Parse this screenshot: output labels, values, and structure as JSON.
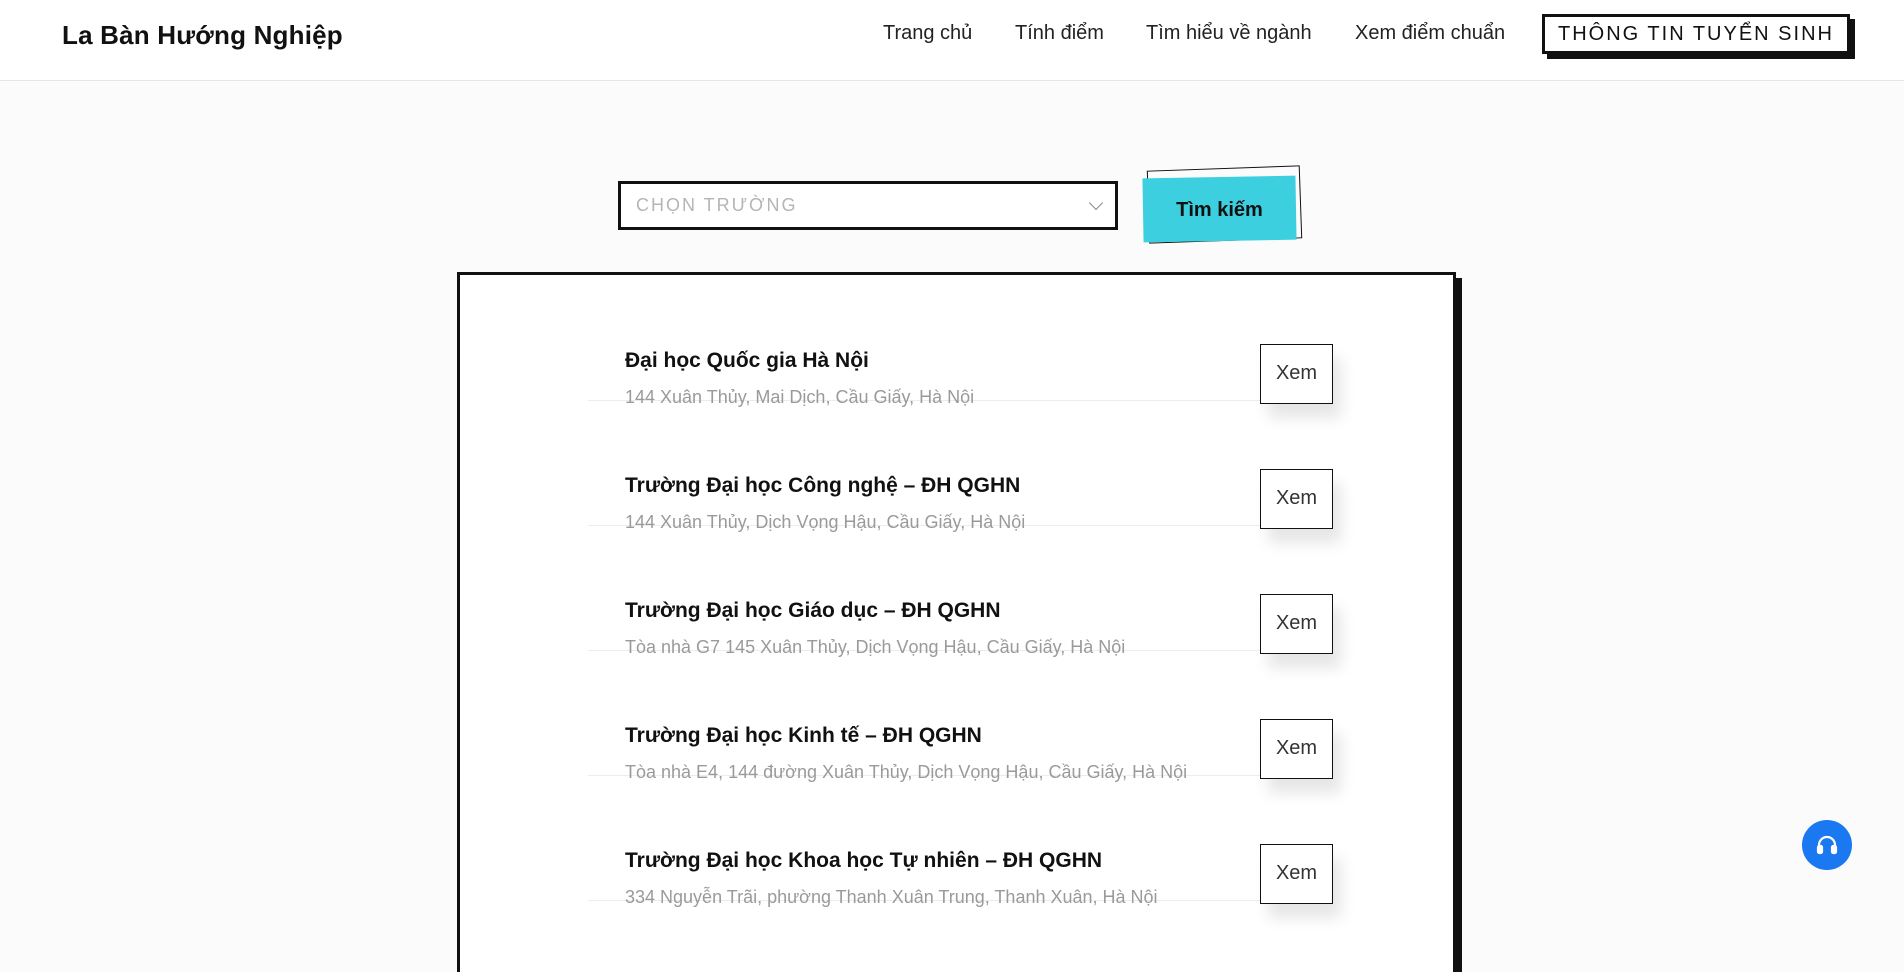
{
  "header": {
    "brand": "La Bàn Hướng Nghiệp",
    "nav": [
      "Trang chủ",
      "Tính điểm",
      "Tìm hiểu về ngành",
      "Xem điểm chuẩn"
    ],
    "cta": "THÔNG TIN TUYỂN SINH"
  },
  "search": {
    "select_placeholder": "CHỌN TRƯỜNG",
    "button_label": "Tìm kiếm"
  },
  "schools": [
    {
      "name": "Đại học Quốc gia Hà Nội",
      "address": "144 Xuân Thủy, Mai Dịch, Cầu Giấy, Hà Nội",
      "action": "Xem"
    },
    {
      "name": "Trường Đại học Công nghệ – ĐH QGHN",
      "address": "144 Xuân Thủy, Dịch Vọng Hậu, Cầu Giấy, Hà Nội",
      "action": "Xem"
    },
    {
      "name": "Trường Đại học Giáo dục – ĐH QGHN",
      "address": "Tòa nhà G7 145 Xuân Thủy, Dịch Vọng Hậu, Cầu Giấy, Hà Nội",
      "action": "Xem"
    },
    {
      "name": "Trường Đại học Kinh tế – ĐH QGHN",
      "address": "Tòa nhà E4, 144 đường Xuân Thủy, Dịch Vọng Hậu, Cầu Giấy, Hà Nội",
      "action": "Xem"
    },
    {
      "name": "Trường Đại học Khoa học Tự nhiên – ĐH QGHN",
      "address": "334 Nguyễn Trãi, phường Thanh Xuân Trung, Thanh Xuân, Hà Nội",
      "action": "Xem"
    }
  ],
  "support": {
    "icon": "headset-icon"
  },
  "colors": {
    "accent": "#3ccfe0",
    "support": "#1a78f0",
    "text": "#111111",
    "muted": "#9a9a9a"
  }
}
